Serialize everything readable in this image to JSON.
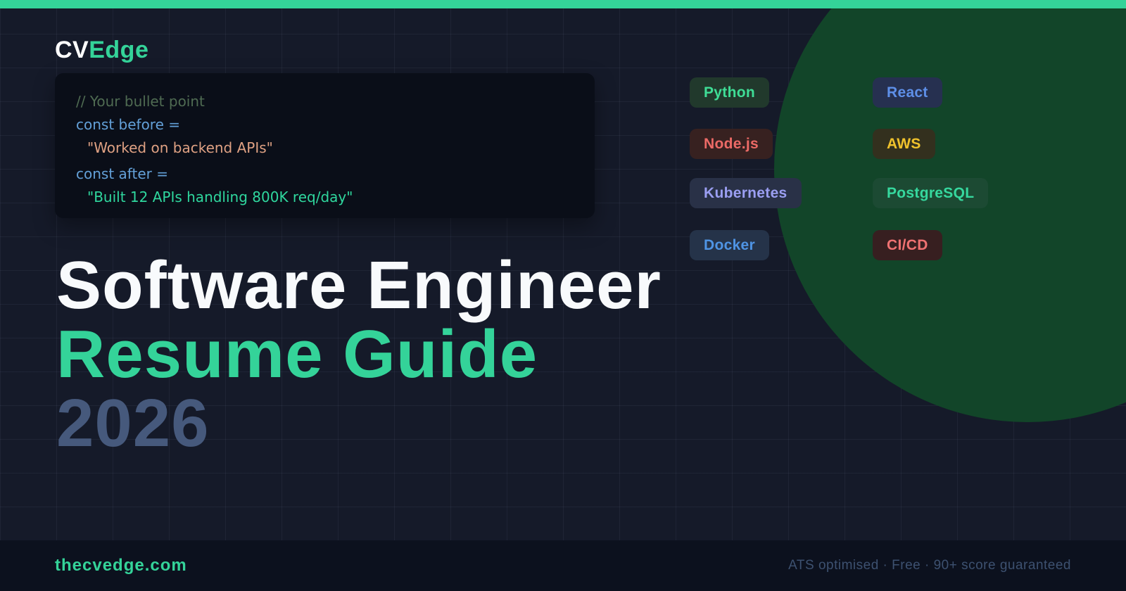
{
  "brand": {
    "logo_prefix": "CV",
    "logo_suffix": "Edge"
  },
  "code_snippet": {
    "comment": "// Your bullet point",
    "before_label": "const before =",
    "before_value": "\"Worked on backend APIs\"",
    "after_label": "const after =",
    "after_value": "\"Built 12 APIs handling 800K req/day\""
  },
  "badges": {
    "left": [
      {
        "label": "Python",
        "fg": "#3fdd96",
        "bg": "#21392c"
      },
      {
        "label": "Node.js",
        "fg": "#ec6a66",
        "bg": "#372120"
      },
      {
        "label": "Kubernetes",
        "fg": "#9b9ff2",
        "bg": "#293147"
      },
      {
        "label": "Docker",
        "fg": "#4f94e4",
        "bg": "#253349"
      }
    ],
    "right": [
      {
        "label": "React",
        "fg": "#5e8fe8",
        "bg": "#263050"
      },
      {
        "label": "AWS",
        "fg": "#f0c22c",
        "bg": "#33301e"
      },
      {
        "label": "PostgreSQL",
        "fg": "#36d89e",
        "bg": "#1c4a33"
      },
      {
        "label": "CI/CD",
        "fg": "#ef7272",
        "bg": "#371f20"
      }
    ]
  },
  "headline": {
    "line1": "Software Engineer",
    "line2": "Resume Guide",
    "line3": "2026"
  },
  "footer": {
    "site": "thecvedge.com",
    "tagline": "ATS optimised · Free · 90+ score guaranteed"
  },
  "colors": {
    "accent_green": "#34d399",
    "circle_green": "#124529",
    "background": "#151a29",
    "footer_background": "#0c111e",
    "year_muted_blue": "#46597c",
    "tagline_muted": "#3d5170",
    "code_card_background": "#0a0e18",
    "code_comment": "#4f6b52",
    "code_keyword_blue": "#63a0d8",
    "code_string_orange": "#dfa183",
    "code_string_green": "#2fd79e"
  }
}
